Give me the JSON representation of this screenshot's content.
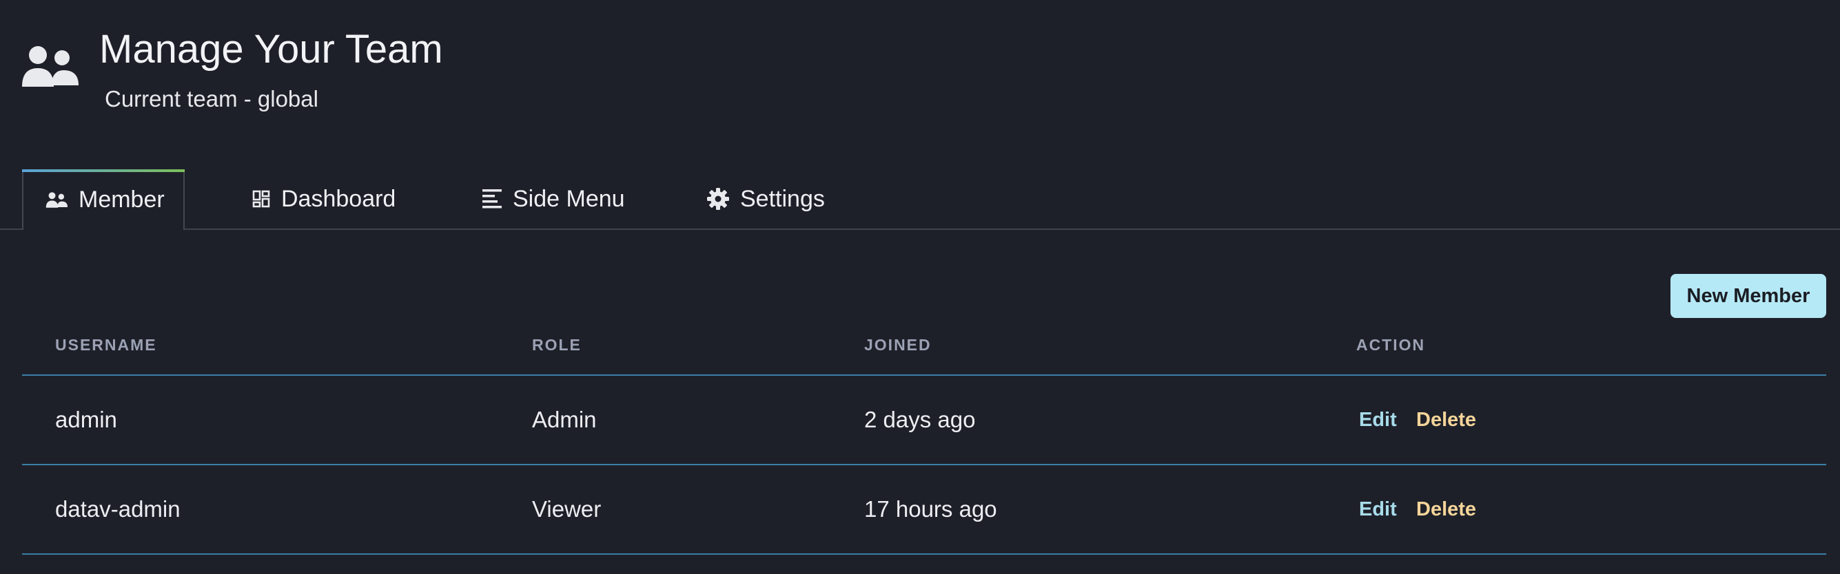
{
  "header": {
    "icon": "team-icon",
    "title": "Manage Your Team",
    "subtitle": "Current team - global"
  },
  "tabs": [
    {
      "label": "Member",
      "icon": "team-icon",
      "active": true
    },
    {
      "label": "Dashboard",
      "icon": "dashboard-icon",
      "active": false
    },
    {
      "label": "Side Menu",
      "icon": "menu-icon",
      "active": false
    },
    {
      "label": "Settings",
      "icon": "gear-icon",
      "active": false
    }
  ],
  "toolbar": {
    "new_member_label": "New Member"
  },
  "table": {
    "columns": [
      "USERNAME",
      "ROLE",
      "JOINED",
      "ACTION"
    ],
    "rows": [
      {
        "username": "admin",
        "role": "Admin",
        "joined": "2 days ago",
        "edit": "Edit",
        "delete": "Delete"
      },
      {
        "username": "datav-admin",
        "role": "Viewer",
        "joined": "17 hours ago",
        "edit": "Edit",
        "delete": "Delete"
      }
    ]
  },
  "colors": {
    "background": "#1e2029",
    "accent_button": "#b5e9f5",
    "edit_link": "#a8dcea",
    "delete_link": "#f5d59a",
    "row_divider": "#3b7fa8",
    "tab_indicator_start": "#5aa2d8",
    "tab_indicator_end": "#7cc05a"
  }
}
